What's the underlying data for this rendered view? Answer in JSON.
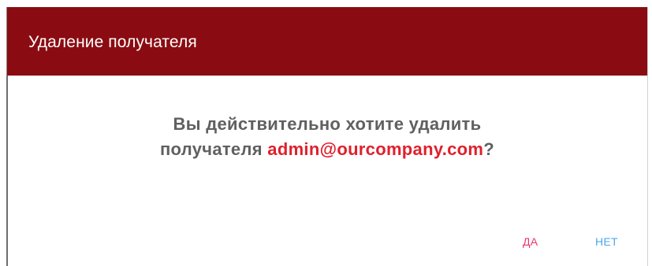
{
  "dialog": {
    "title": "Удаление получателя",
    "message_line1": "Вы действительно хотите удалить",
    "message_line2_prefix": "получателя ",
    "recipient_email": "admin@ourcompany.com",
    "message_suffix": "?",
    "yes_label": "ДА",
    "no_label": "НЕТ"
  },
  "colors": {
    "header_bg": "#8a0c12",
    "header_text": "#ffffff",
    "message_text": "#606060",
    "email_text": "#e0202c",
    "yes_button": "#e8386a",
    "no_button": "#4aa8e8"
  }
}
